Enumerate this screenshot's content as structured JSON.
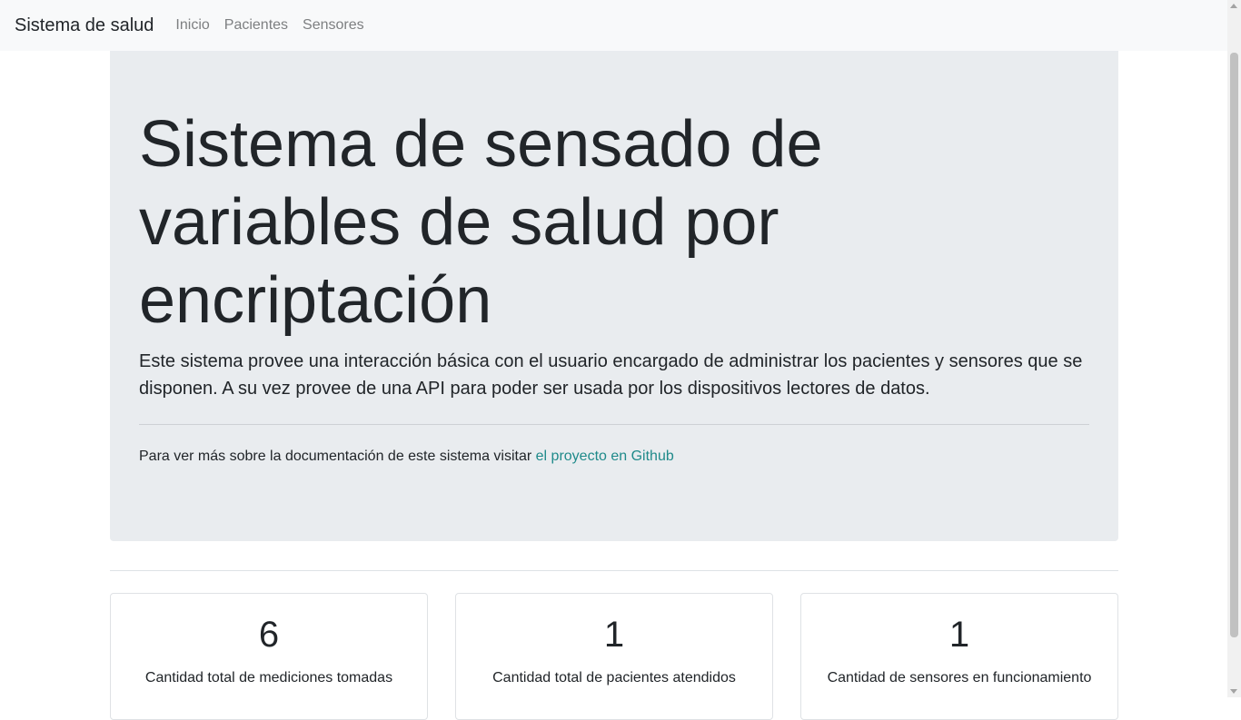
{
  "navbar": {
    "brand": "Sistema de salud",
    "links": [
      {
        "label": "Inicio"
      },
      {
        "label": "Pacientes"
      },
      {
        "label": "Sensores"
      }
    ]
  },
  "hero": {
    "title": "Sistema de sensado de variables de salud por encriptación",
    "lead": "Este sistema provee una interacción básica con el usuario encargado de administrar los pacientes y sensores que se disponen. A su vez provee de una API para poder ser usada por los dispositivos lectores de datos.",
    "doc_text": "Para ver más sobre la documentación de este sistema visitar ",
    "doc_link": "el proyecto en Github"
  },
  "stats": [
    {
      "value": "6",
      "label": "Cantidad total de mediciones tomadas"
    },
    {
      "value": "1",
      "label": "Cantidad total de pacientes atendidos"
    },
    {
      "value": "1",
      "label": "Cantidad de sensores en funcionamiento"
    }
  ],
  "colors": {
    "navbar_bg": "#f8f9fa",
    "jumbotron_bg": "#e9ecef",
    "link": "#1f8a8a",
    "nav_link": "#7d7f81"
  }
}
